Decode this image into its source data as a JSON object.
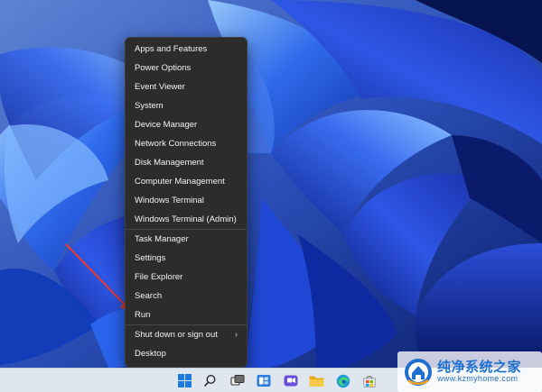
{
  "context_menu": {
    "groups": [
      [
        {
          "label": "Apps and Features"
        },
        {
          "label": "Power Options"
        },
        {
          "label": "Event Viewer"
        },
        {
          "label": "System"
        },
        {
          "label": "Device Manager"
        },
        {
          "label": "Network Connections"
        },
        {
          "label": "Disk Management"
        },
        {
          "label": "Computer Management"
        },
        {
          "label": "Windows Terminal"
        },
        {
          "label": "Windows Terminal (Admin)"
        }
      ],
      [
        {
          "label": "Task Manager"
        },
        {
          "label": "Settings"
        },
        {
          "label": "File Explorer"
        },
        {
          "label": "Search"
        },
        {
          "label": "Run"
        }
      ],
      [
        {
          "label": "Shut down or sign out",
          "submenu": true
        },
        {
          "label": "Desktop"
        }
      ]
    ],
    "submenu_chevron": "›"
  },
  "annotation": {
    "color": "#e8392b",
    "points_to": "Run"
  },
  "taskbar": {
    "icons": [
      "windows-start-icon",
      "search-icon",
      "task-view-icon",
      "widgets-icon",
      "chat-icon",
      "file-explorer-icon",
      "edge-icon",
      "store-icon"
    ]
  },
  "watermark": {
    "title": "纯净系统之家",
    "url": "www.kzmyhome.com"
  },
  "colors": {
    "menu_bg": "#2c2c2c",
    "menu_text": "#f2f2f2",
    "taskbar_bg": "#dfe6ef",
    "accent": "#1b5ec9"
  }
}
